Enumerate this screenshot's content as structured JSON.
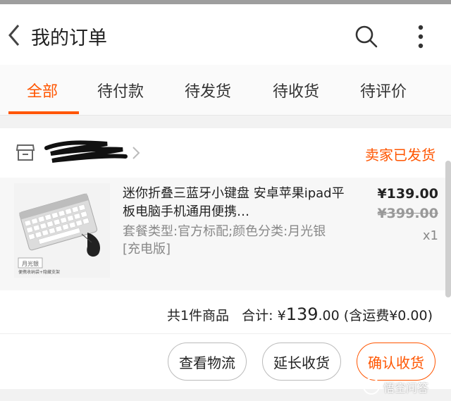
{
  "header": {
    "title": "我的订单",
    "icons": {
      "back": "back-arrow-icon",
      "search": "search-icon",
      "more": "more-vertical-icon"
    }
  },
  "tabs": [
    {
      "label": "全部",
      "active": true
    },
    {
      "label": "待付款",
      "active": false
    },
    {
      "label": "待发货",
      "active": false
    },
    {
      "label": "待收货",
      "active": false
    },
    {
      "label": "待评价",
      "active": false
    }
  ],
  "order": {
    "shop_status": "卖家已发货",
    "item": {
      "title": "迷你折叠三蓝牙小键盘 安卓苹果ipad平板电脑手机通用便携…",
      "spec": "套餐类型:官方标配;颜色分类:月光银[充电版]",
      "price": "¥139.00",
      "original_price": "¥399.00",
      "quantity": "x1",
      "thumb_label": "月光银",
      "thumb_caption": "便携收纳袋+隐藏支架"
    },
    "summary": {
      "count_text": "共1件商品",
      "total_label": "合计: ¥",
      "total_int": "139",
      "total_dec": ".00",
      "shipping_text": "(含运费¥0.00)"
    },
    "actions": {
      "logistics": "查看物流",
      "extend": "延长收货",
      "confirm": "确认收货"
    }
  },
  "watermark": {
    "text": "悟空问答"
  },
  "colors": {
    "accent": "#ff5500",
    "header_bar": "#9e9e9e"
  }
}
